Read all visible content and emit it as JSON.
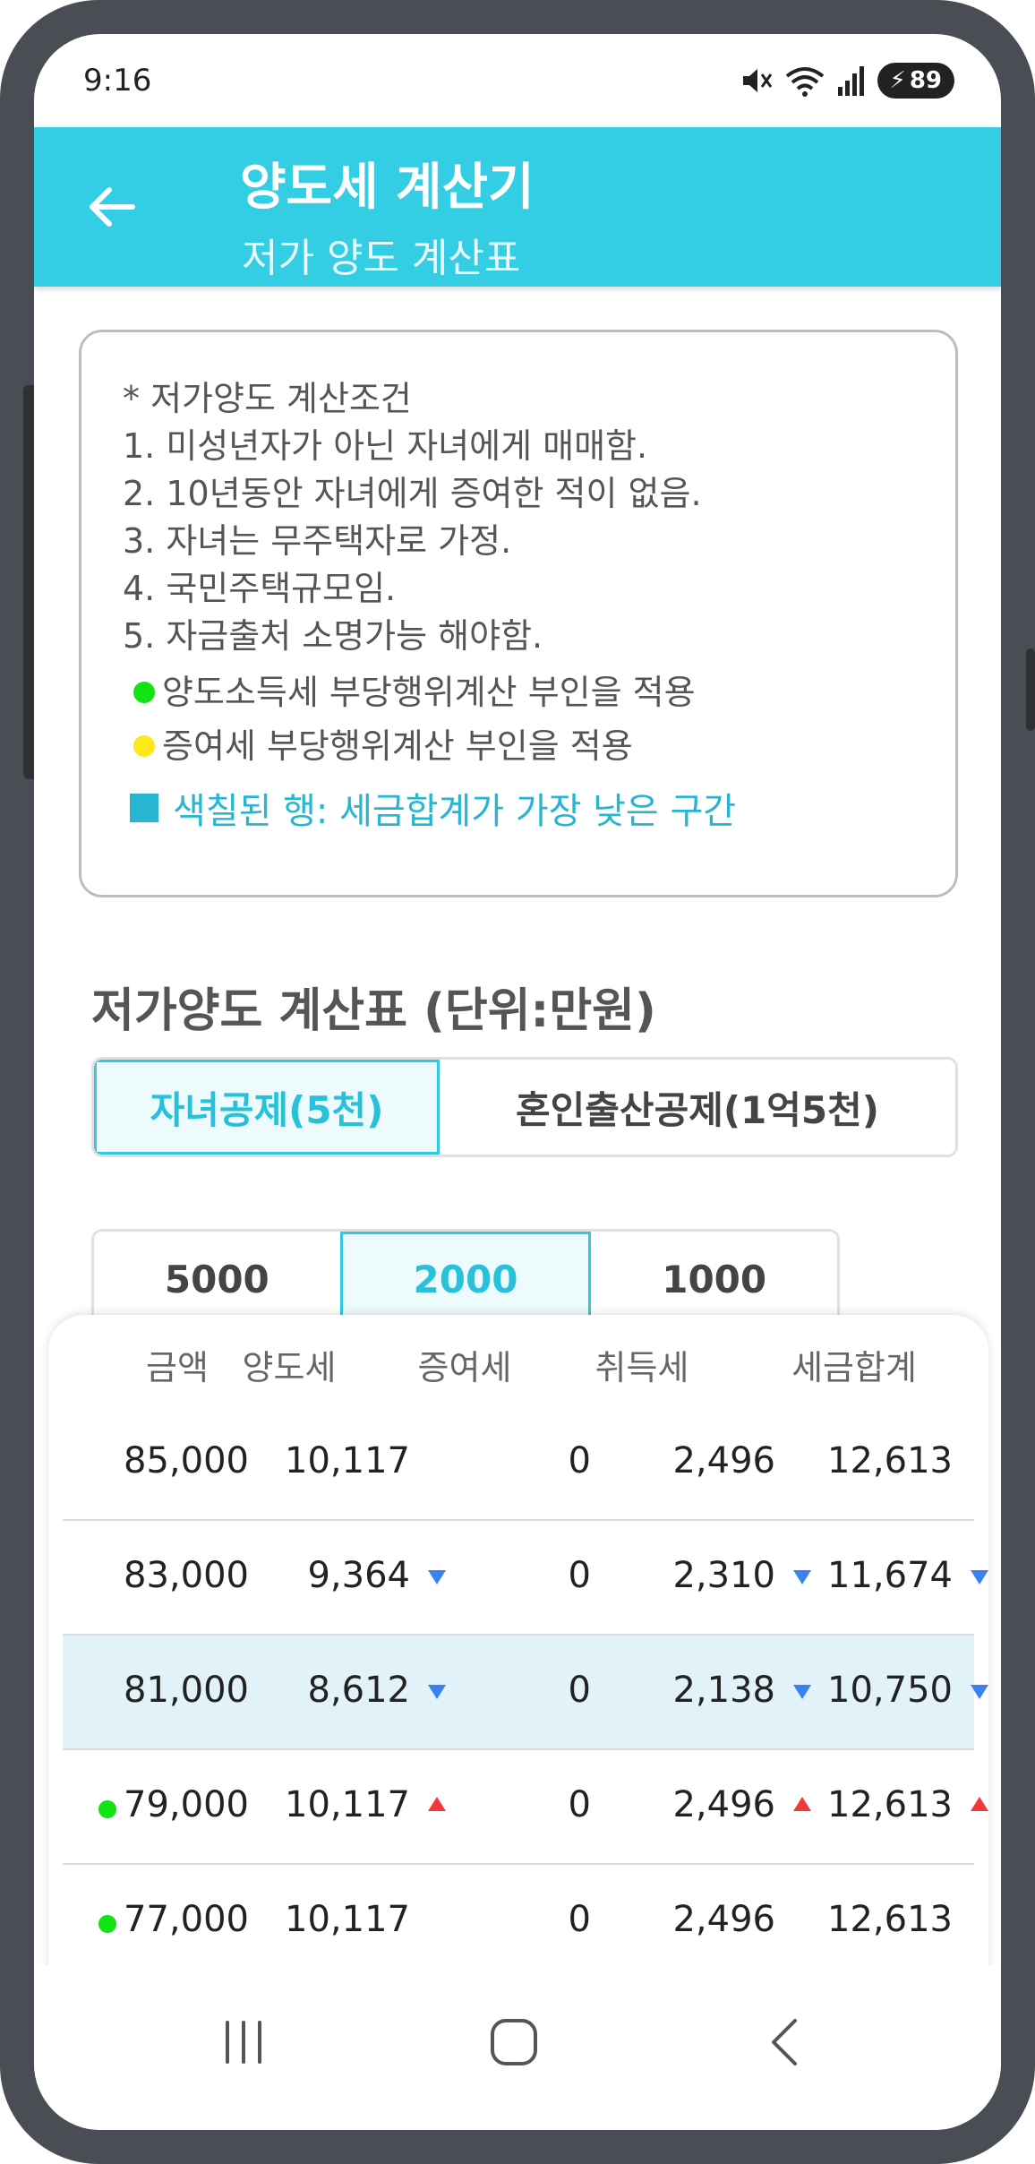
{
  "status_bar": {
    "time": "9:16",
    "icons": [
      "mute-icon",
      "wifi-icon",
      "signal-icon",
      "battery-icon"
    ],
    "battery_level": "89"
  },
  "header": {
    "title": "양도세 계산기",
    "subtitle": "저가 양도 계산표"
  },
  "conditions": {
    "heading": "* 저가양도 계산조건",
    "items": [
      "1. 미성년자가 아닌 자녀에게 매매함.",
      "2. 10년동안 자녀에게 증여한 적이 없음.",
      "3. 자녀는 무주택자로 가정.",
      "4. 국민주택규모임.",
      "5. 자금출처 소명가능 해야함."
    ],
    "legend": {
      "green": "양도소득세 부당행위계산 부인을 적용",
      "yellow": "증여세 부당행위계산 부인을 적용",
      "highlight": "색칠된 행: 세금합계가 가장 낮은 구간"
    }
  },
  "section_title": "저가양도 계산표 (단위:만원)",
  "deduction_tabs": {
    "selected": "자녀공제(5천)",
    "items": [
      "자녀공제(5천)",
      "혼인출산공제(1억5천)"
    ]
  },
  "step_tabs": {
    "selected": "2000",
    "items": [
      "5000",
      "2000",
      "1000"
    ]
  },
  "table": {
    "headers": [
      "금액",
      "양도세",
      "증여세",
      "취득세",
      "세금합계"
    ],
    "rows": [
      {
        "amount": "85,000",
        "transfer_tax": "10,117",
        "gift_tax": "0",
        "acq_tax": "2,496",
        "total": "12,613",
        "trend": "none",
        "marker": "none",
        "highlight": false
      },
      {
        "amount": "83,000",
        "transfer_tax": "9,364",
        "gift_tax": "0",
        "acq_tax": "2,310",
        "total": "11,674",
        "trend": "down",
        "marker": "none",
        "highlight": false
      },
      {
        "amount": "81,000",
        "transfer_tax": "8,612",
        "gift_tax": "0",
        "acq_tax": "2,138",
        "total": "10,750",
        "trend": "down",
        "marker": "none",
        "highlight": true
      },
      {
        "amount": "79,000",
        "transfer_tax": "10,117",
        "gift_tax": "0",
        "acq_tax": "2,496",
        "total": "12,613",
        "trend": "up",
        "marker": "green",
        "highlight": false
      },
      {
        "amount": "77,000",
        "transfer_tax": "10,117",
        "gift_tax": "0",
        "acq_tax": "2,496",
        "total": "12,613",
        "trend": "none",
        "marker": "green",
        "highlight": false
      }
    ]
  },
  "nav_bar": {
    "items": [
      "recents-icon",
      "home-icon",
      "back-icon"
    ]
  },
  "colors": {
    "accent": "#33cde4",
    "highlight_row": "#e1f3f8",
    "down_arrow": "#3a82f0",
    "up_arrow": "#f03a3a",
    "green_marker": "#12e312",
    "yellow_marker": "#ffe81c"
  }
}
